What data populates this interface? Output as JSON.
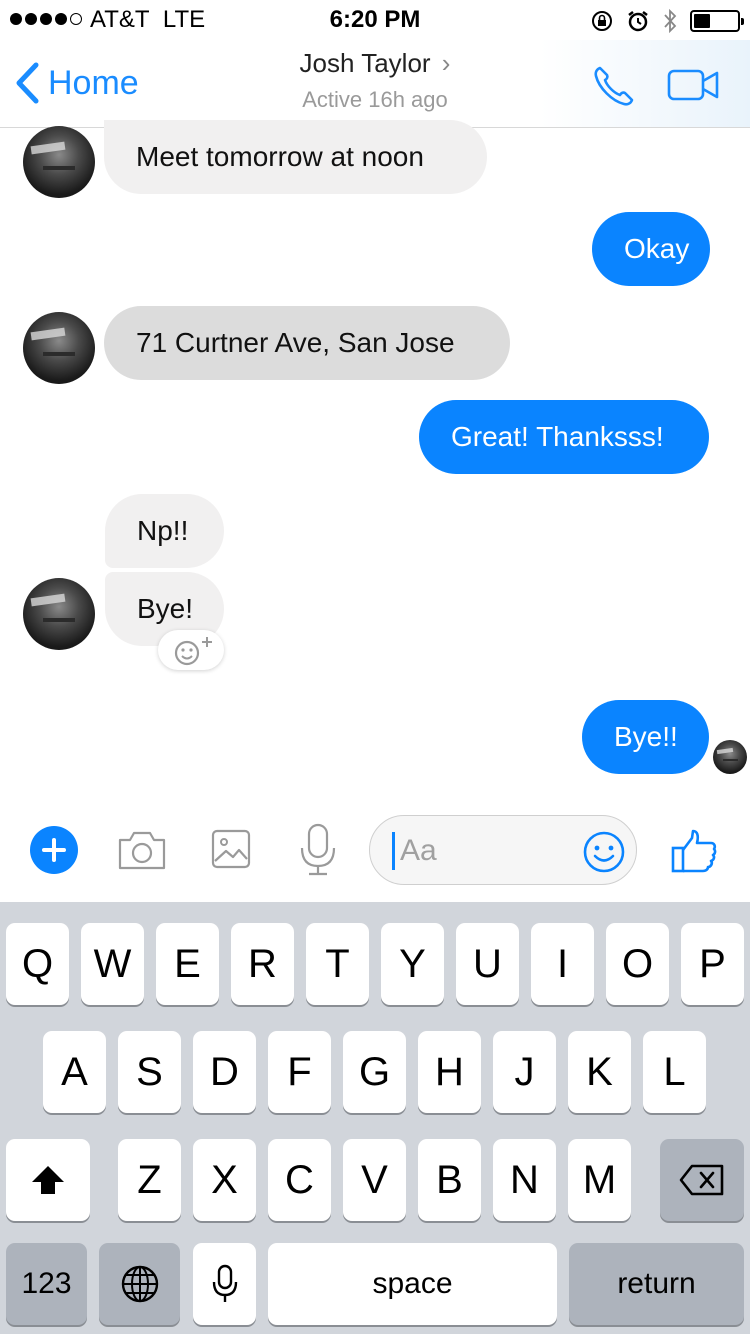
{
  "status_bar": {
    "carrier": "AT&T",
    "network": "LTE",
    "time": "6:20 PM"
  },
  "nav": {
    "back_label": "Home",
    "contact_name": "Josh Taylor",
    "contact_status": "Active 16h ago"
  },
  "messages": [
    {
      "direction": "in",
      "text": "Meet tomorrow at noon"
    },
    {
      "direction": "out",
      "text": "Okay"
    },
    {
      "direction": "in",
      "text": "71 Curtner Ave, San Jose"
    },
    {
      "direction": "out",
      "text": "Great! Thanksss!"
    },
    {
      "direction": "in",
      "text": "Np!!"
    },
    {
      "direction": "in",
      "text": "Bye!"
    },
    {
      "direction": "out",
      "text": "Bye!!"
    }
  ],
  "composer": {
    "placeholder": "Aa"
  },
  "keyboard": {
    "row1": [
      "Q",
      "W",
      "E",
      "R",
      "T",
      "Y",
      "U",
      "I",
      "O",
      "P"
    ],
    "row2": [
      "A",
      "S",
      "D",
      "F",
      "G",
      "H",
      "J",
      "K",
      "L"
    ],
    "row3": [
      "Z",
      "X",
      "C",
      "V",
      "B",
      "N",
      "M"
    ],
    "numbers_label": "123",
    "space_label": "space",
    "return_label": "return"
  },
  "colors": {
    "accent": "#0a84ff",
    "incoming_bubble": "#f1f0f0",
    "keyboard_bg": "#d1d5db"
  },
  "icons": [
    "phone-icon",
    "video-camera-icon",
    "plus-icon",
    "camera-icon",
    "image-icon",
    "microphone-icon",
    "smiley-icon",
    "thumbs-up-icon",
    "globe-icon",
    "shift-icon",
    "backspace-icon",
    "add-reaction-icon"
  ]
}
